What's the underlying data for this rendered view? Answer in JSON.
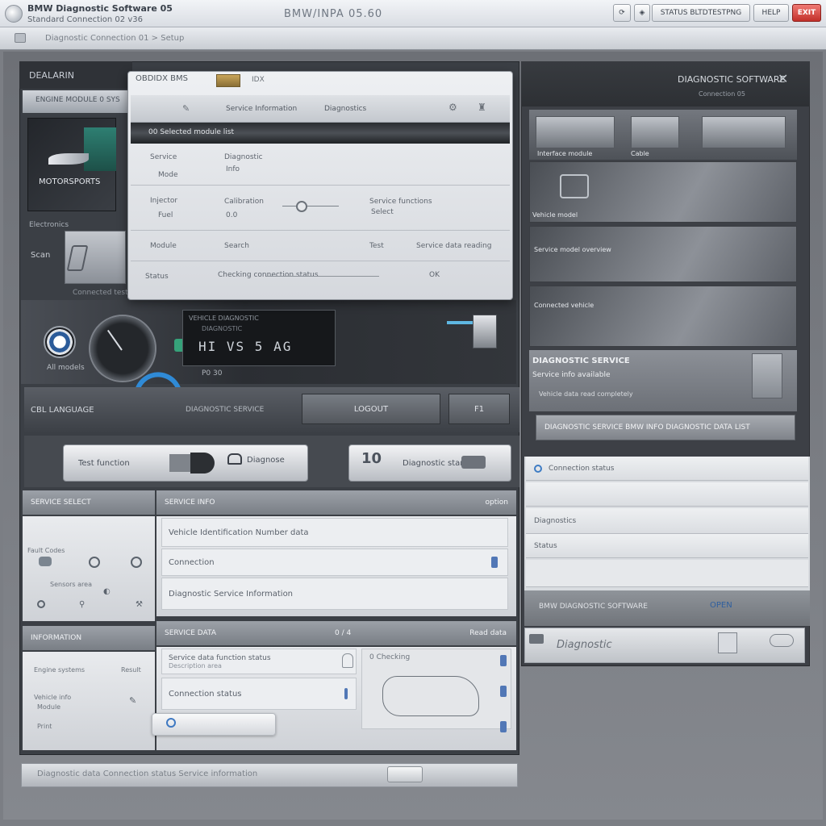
{
  "titlebar": {
    "title": "BMW Diagnostic Software 05",
    "subtitle": "Standard Connection 02 v36",
    "center_title": "BMW/INPA 05.60",
    "btn_status": "STATUS  BLTDTESTPNG",
    "btn_help": "HELP",
    "btn_close": "EXIT"
  },
  "toolbar": {
    "path": "Diagnostic  Connection  01  >  Setup"
  },
  "left_panel": {
    "title": "DEALARIN",
    "strip_text": "ENGINE MODULE 0 SYS",
    "brand_label": "MOTORSPORTS",
    "label_below": "Electronics",
    "label_side": "Scan",
    "thumb_caption": "Connected test unit",
    "logo_caption": "All models",
    "readout_head": "VEHICLE DIAGNOSTIC",
    "readout_sub": "DIAGNOSTIC",
    "readout_value": "HI  VS  5  AG",
    "readout_code": "P0 30"
  },
  "mode_bar": {
    "label_left": "CBL LANGUAGE",
    "label_mid": "DIAGNOSTIC SERVICE",
    "btn_right1": "LOGOUT",
    "btn_right2": "F1"
  },
  "actions": {
    "left_label": "Test function",
    "left_right_label": "Diagnose",
    "big_number": "10",
    "right_label": "Diagnostic start"
  },
  "lower_left": {
    "head_a": "SERVICE SELECT",
    "head_b": "SERVICE INFO",
    "head_b_right": "option",
    "row1": "Vehicle Identification Number data",
    "row2": "Connection",
    "row3": "Diagnostic Service Information",
    "sidebar_top": "Fault Codes",
    "sidebar_mid": "Sensors area",
    "head_c": "INFORMATION",
    "head_d": "SERVICE DATA",
    "head_d_mid": "0 / 4",
    "head_d_right": "Read data",
    "row4": "Service data function status",
    "row4_sub": "Description area",
    "row5": "Connection status",
    "row5_side": "0  Checking",
    "side_a": "Engine systems",
    "side_b": "Result",
    "side_c": "Vehicle info",
    "side_d": "Module",
    "side_e": "Print"
  },
  "dialog": {
    "title": "OBDIDX  BMS",
    "title_tag": "IDX",
    "tab_1": "Service Information",
    "tab_2": "Diagnostics",
    "selected": "00 Selected module list",
    "r1_k": "Service",
    "r1_v": "Diagnostic",
    "r1_v2": "Info",
    "r1_sub": "Mode",
    "r2_k": "Injector",
    "r2_k2": "Fuel",
    "r2_v": "Calibration",
    "r2_v2": "0.0",
    "r2_right": "Service functions",
    "r2_right2": "Select",
    "r3_k": "Module",
    "r3_v": "Search",
    "r3_mid": "Test",
    "r3_right": "Service data reading",
    "footer_left": "Status",
    "footer_mid": "Checking connection status",
    "footer_right": "OK"
  },
  "right_panel": {
    "title": "DIAGNOSTIC SOFTWARE",
    "subtitle": "Connection 05",
    "thumb_caption_1": "Interface module",
    "thumb_caption_2": "Cable",
    "img1_caption": "Vehicle model",
    "img2_caption": "Service model overview",
    "img3_caption": "Connected vehicle",
    "info_title": "DIAGNOSTIC SERVICE",
    "info_sub": "Service info available",
    "info_detail": "Vehicle data read completely",
    "banner": "DIAGNOSTIC SERVICE BMW INFO DIAGNOSTIC DATA LIST",
    "list_1": "Connection status",
    "list_2": "",
    "list_3": "Diagnostics",
    "list_3_sub": "Status",
    "footer_text": "BMW DIAGNOSTIC SOFTWARE",
    "footer_link": "OPEN",
    "signature": "Diagnostic"
  },
  "bottombar": {
    "text": "Diagnostic data     Connection status     Service information"
  }
}
